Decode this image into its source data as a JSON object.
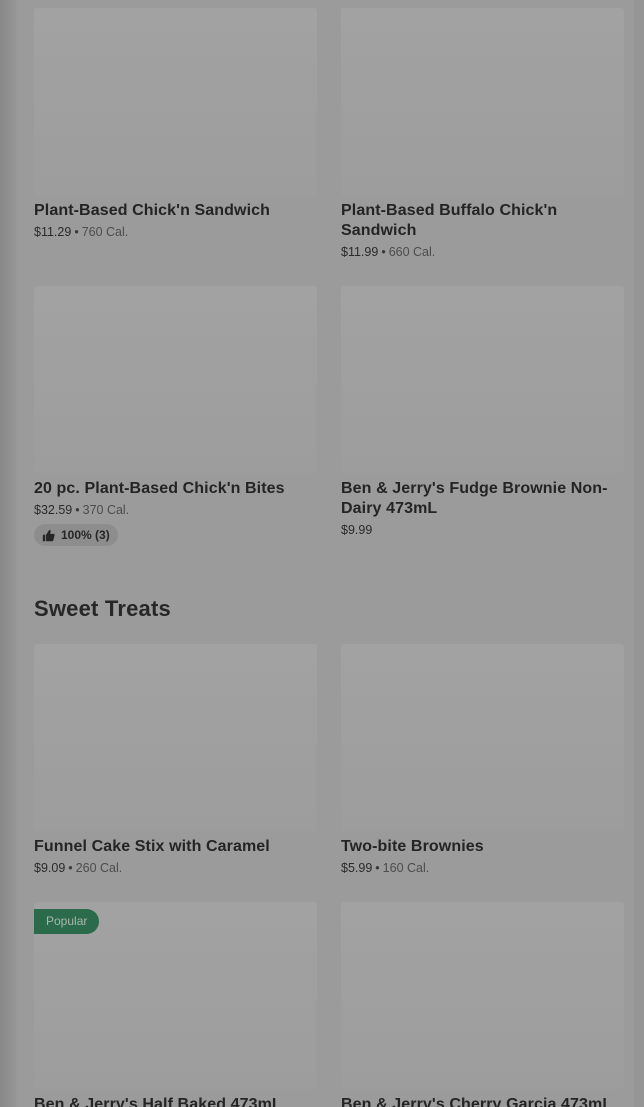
{
  "menu": {
    "section_title": "Sweet Treats",
    "items": [
      {
        "name": "Plant-Based Chick'n Sandwich",
        "price": "$11.29",
        "calories": "760 Cal."
      },
      {
        "name": "Plant-Based Buffalo Chick'n Sandwich",
        "price": "$11.99",
        "calories": "660 Cal."
      },
      {
        "name": "20 pc. Plant-Based Chick'n Bites",
        "price": "$32.59",
        "calories": "370 Cal.",
        "rating": "100% (3)"
      },
      {
        "name": "Ben & Jerry's Fudge Brownie Non-Dairy 473mL",
        "price": "$9.99"
      },
      {
        "name": "Funnel Cake Stix with Caramel",
        "price": "$9.09",
        "calories": "260 Cal."
      },
      {
        "name": "Two-bite Brownies",
        "price": "$5.99",
        "calories": "160 Cal."
      },
      {
        "name": "Ben & Jerry's Half Baked 473mL",
        "badge": "Popular"
      },
      {
        "name": "Ben & Jerry's Cherry Garcia 473mL"
      }
    ]
  },
  "icons": {
    "rating": "thumbs-up-icon"
  },
  "colors": {
    "overlay": "#9b9b9b",
    "badge": "#2b6a4b"
  }
}
